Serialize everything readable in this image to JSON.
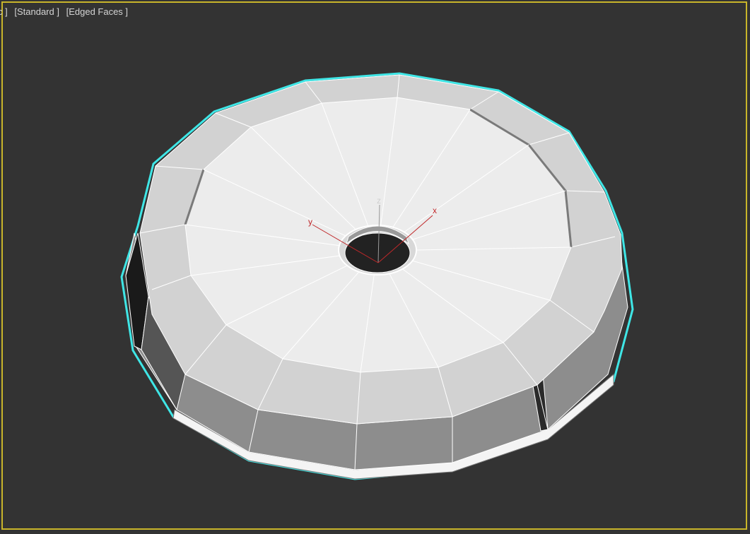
{
  "viewport": {
    "labels": [
      "c ]",
      "[Standard ]",
      "[Edged Faces ]"
    ],
    "active_border_color": "#c9b52a",
    "background_color": "#333333"
  },
  "gizmo": {
    "x_label": "x",
    "y_label": "y",
    "z_label": "z",
    "x_color": "#c0282a",
    "y_color": "#c0282a",
    "z_color": "#9a9a9a"
  },
  "object": {
    "description_icon": "torus-mesh",
    "selection_color": "#3fe6e6",
    "face_color": "#e8e8e8",
    "side_color": "#8a8a8a"
  }
}
